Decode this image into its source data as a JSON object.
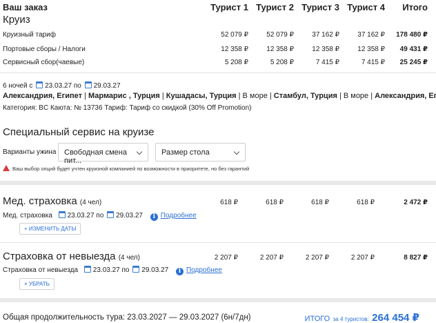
{
  "order": {
    "title": "Ваш заказ",
    "subtitle": "Круиз",
    "columns": [
      "Турист 1",
      "Турист 2",
      "Турист 3",
      "Турист 4",
      "Итого"
    ],
    "rows": [
      {
        "label": "Круизный тариф",
        "values": [
          "52 079 ₽",
          "52 079 ₽",
          "37 162 ₽",
          "37 162 ₽"
        ],
        "total": "178 480 ₽"
      },
      {
        "label": "Портовые сборы / Налоги",
        "values": [
          "12 358 ₽",
          "12 358 ₽",
          "12 358 ₽",
          "12 358 ₽"
        ],
        "total": "49 431 ₽"
      },
      {
        "label": "Сервисный сбор(чаевые)",
        "values": [
          "5 208 ₽",
          "5 208 ₽",
          "7 415 ₽",
          "7 415 ₽"
        ],
        "total": "25 245 ₽"
      }
    ]
  },
  "cruise": {
    "nights": "6 ночей с",
    "date_from": "23.03.27",
    "by": "по",
    "date_to": "29.03.27",
    "route": [
      {
        "text": "Александрия, Египет",
        "bold": true
      },
      {
        "text": " | ",
        "bold": false
      },
      {
        "text": "Мармарис , Турция",
        "bold": true
      },
      {
        "text": " | ",
        "bold": false
      },
      {
        "text": "Кушадасы, Турция",
        "bold": true
      },
      {
        "text": " | В море | ",
        "bold": false
      },
      {
        "text": "Стамбул, Турция",
        "bold": true
      },
      {
        "text": " | В море | ",
        "bold": false
      },
      {
        "text": "Александрия, Египет",
        "bold": true
      }
    ],
    "details": "Категория: BC  Каюта: № 13736  Тариф: Тариф со скидкой (30% Off Promotion)"
  },
  "special": {
    "title": "Специальный сервис на круизе",
    "dinner_label": "Варианты ужина",
    "dinner_value": "Свободная смена пит...",
    "table_value": "Размер стола",
    "warning": "Ваш выбор опций будет учтен круизной компанией по возможности в приоритете, но без гарантий"
  },
  "medical": {
    "title": "Мед. страховка",
    "count": "(4 чел)",
    "values": [
      "618 ₽",
      "618 ₽",
      "618 ₽",
      "618 ₽"
    ],
    "total": "2 472 ₽",
    "label": "Мед. страховка",
    "date_from": "23.03.27",
    "by": "по",
    "date_to": "29.03.27",
    "more": "Подробнее",
    "button": "+ ИЗМЕНИТЬ ДАТЫ"
  },
  "cancel": {
    "title": "Страховка от невыезда",
    "count": "(4 чел)",
    "values": [
      "2 207 ₽",
      "2 207 ₽",
      "2 207 ₽",
      "2 207 ₽"
    ],
    "total": "8 827 ₽",
    "label": "Страховка от невыезда",
    "date_from": "23.03.27",
    "by": "по",
    "date_to": "29.03.27",
    "more": "Подробнее",
    "button": "× УБРАТЬ"
  },
  "footer": {
    "duration": "Общая продолжительность тура: 23.03.2027 — 29.03.2027 (6н/7дн)",
    "total_label": "ИТОГО",
    "total_for": "за 4 туристов:",
    "total_sum": "264 454 ₽"
  },
  "colors": {
    "accent": "#2a6fd6",
    "warning": "#d63b3b"
  }
}
